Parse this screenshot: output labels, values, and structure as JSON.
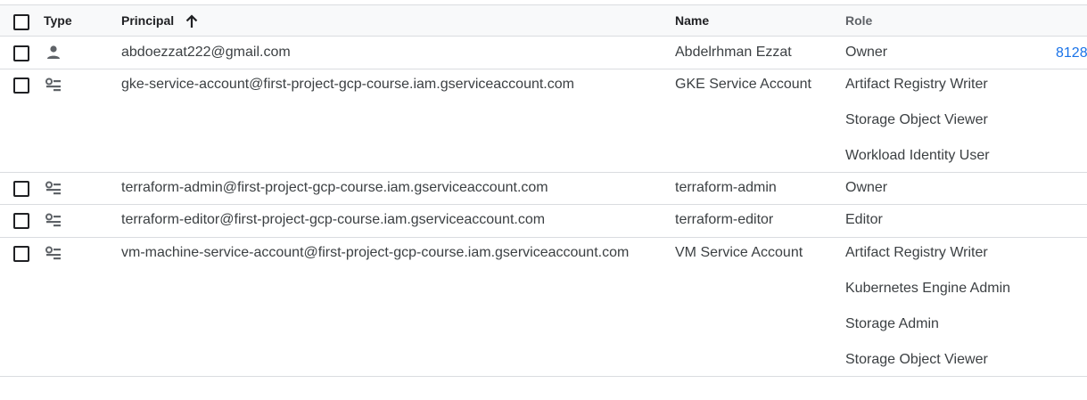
{
  "header": {
    "type": "Type",
    "principal": "Principal",
    "name": "Name",
    "role": "Role"
  },
  "rows": [
    {
      "kind": "person",
      "principal": "abdoezzat222@gmail.com",
      "name": "Abdelrhman Ezzat",
      "roles": [
        "Owner"
      ],
      "extra": "8128"
    },
    {
      "kind": "service-account",
      "principal": "gke-service-account@first-project-gcp-course.iam.gserviceaccount.com",
      "name": "GKE Service Account",
      "roles": [
        "Artifact Registry Writer",
        "Storage Object Viewer",
        "Workload Identity User"
      ]
    },
    {
      "kind": "service-account",
      "principal": "terraform-admin@first-project-gcp-course.iam.gserviceaccount.com",
      "name": "terraform-admin",
      "roles": [
        "Owner"
      ]
    },
    {
      "kind": "service-account",
      "principal": "terraform-editor@first-project-gcp-course.iam.gserviceaccount.com",
      "name": "terraform-editor",
      "roles": [
        "Editor"
      ]
    },
    {
      "kind": "service-account",
      "principal": "vm-machine-service-account@first-project-gcp-course.iam.gserviceaccount.com",
      "name": "VM Service Account",
      "roles": [
        "Artifact Registry Writer",
        "Kubernetes Engine Admin",
        "Storage Admin",
        "Storage Object Viewer"
      ]
    }
  ]
}
